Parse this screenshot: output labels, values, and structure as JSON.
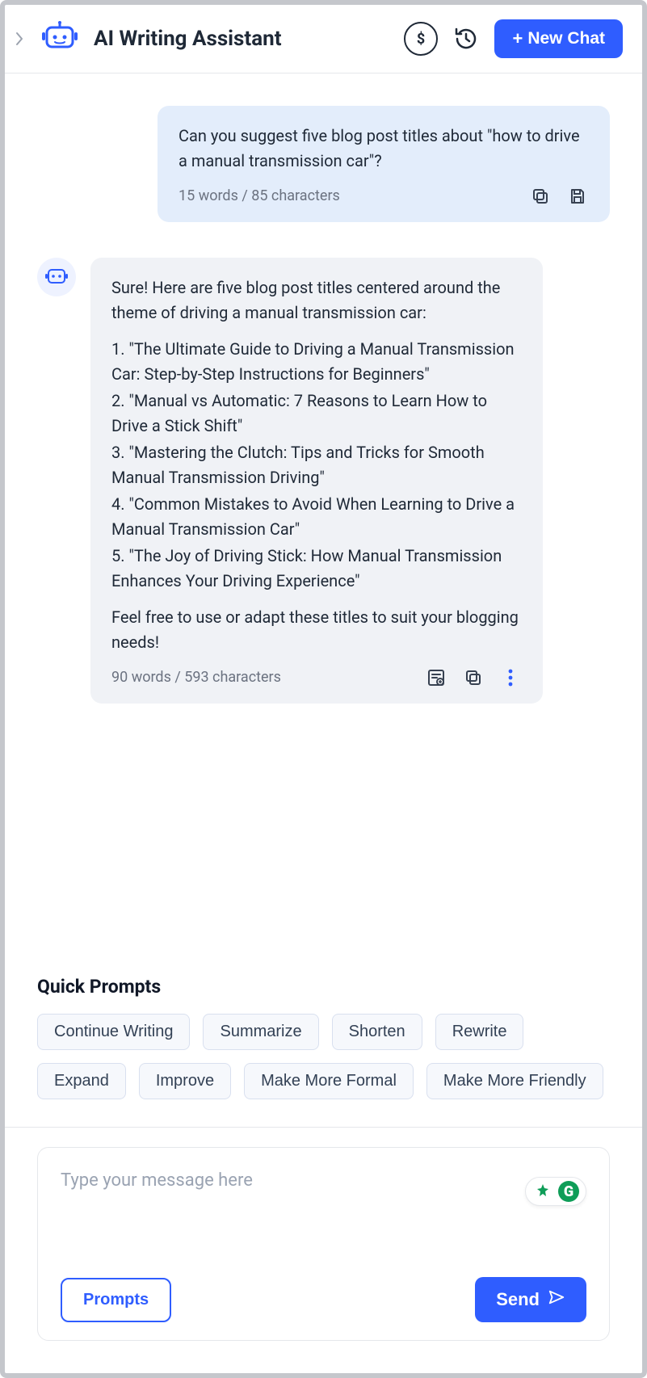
{
  "header": {
    "title": "AI Writing Assistant",
    "new_chat_label": "New Chat"
  },
  "messages": {
    "user": {
      "text": "Can you suggest five blog post titles about \"how to drive a manual transmission car\"?",
      "counts": "15 words / 85 characters"
    },
    "assistant": {
      "intro": "Sure! Here are five blog post titles centered around the theme of driving a manual transmission car:",
      "items": [
        "1. \"The Ultimate Guide to Driving a Manual Transmission Car: Step-by-Step Instructions for Beginners\"",
        "2. \"Manual vs Automatic: 7 Reasons to Learn How to Drive a Stick Shift\"",
        "3. \"Mastering the Clutch: Tips and Tricks for Smooth Manual Transmission Driving\"",
        "4. \"Common Mistakes to Avoid When Learning to Drive a Manual Transmission Car\"",
        "5. \"The Joy of Driving Stick: How Manual Transmission Enhances Your Driving Experience\""
      ],
      "outro": "Feel free to use or adapt these titles to suit your blogging needs!",
      "counts": "90 words / 593 characters"
    }
  },
  "quick_prompts": {
    "title": "Quick Prompts",
    "chips": [
      "Continue Writing",
      "Summarize",
      "Shorten",
      "Rewrite",
      "Expand",
      "Improve",
      "Make More Formal",
      "Make More Friendly"
    ]
  },
  "composer": {
    "placeholder": "Type your message here",
    "prompts_label": "Prompts",
    "send_label": "Send"
  }
}
